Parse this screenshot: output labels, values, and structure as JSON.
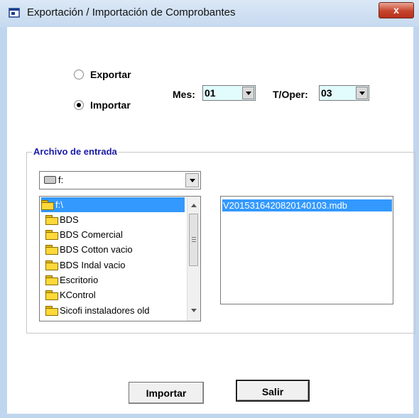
{
  "window": {
    "title": "Exportación / Importación de Comprobantes",
    "close_label": "x"
  },
  "mode": {
    "export_label": "Exportar",
    "import_label": "Importar",
    "selected": "Importar"
  },
  "mes": {
    "label": "Mes:",
    "value": "01"
  },
  "toper": {
    "label": "T/Oper:",
    "value": "03"
  },
  "input_group": {
    "title": "Archivo de entrada",
    "drive": {
      "value": "f:"
    },
    "directories": [
      {
        "label": "f:\\",
        "selected": true
      },
      {
        "label": "BDS"
      },
      {
        "label": "BDS Comercial"
      },
      {
        "label": "BDS Cotton vacio"
      },
      {
        "label": "BDS Indal vacio"
      },
      {
        "label": "Escritorio"
      },
      {
        "label": "KControl"
      },
      {
        "label": "Sicofi instaladores old"
      }
    ],
    "files": [
      {
        "label": "V2015316420820140103.mdb",
        "selected": true
      }
    ]
  },
  "buttons": {
    "import_label": "Importar",
    "exit_label": "Salir"
  },
  "colors": {
    "titlebar": "#c5d9ef",
    "selection": "#3399ff",
    "combo_bg": "#e2fbfd",
    "group_title": "#1a1aa8",
    "close_button": "#c7442d"
  }
}
